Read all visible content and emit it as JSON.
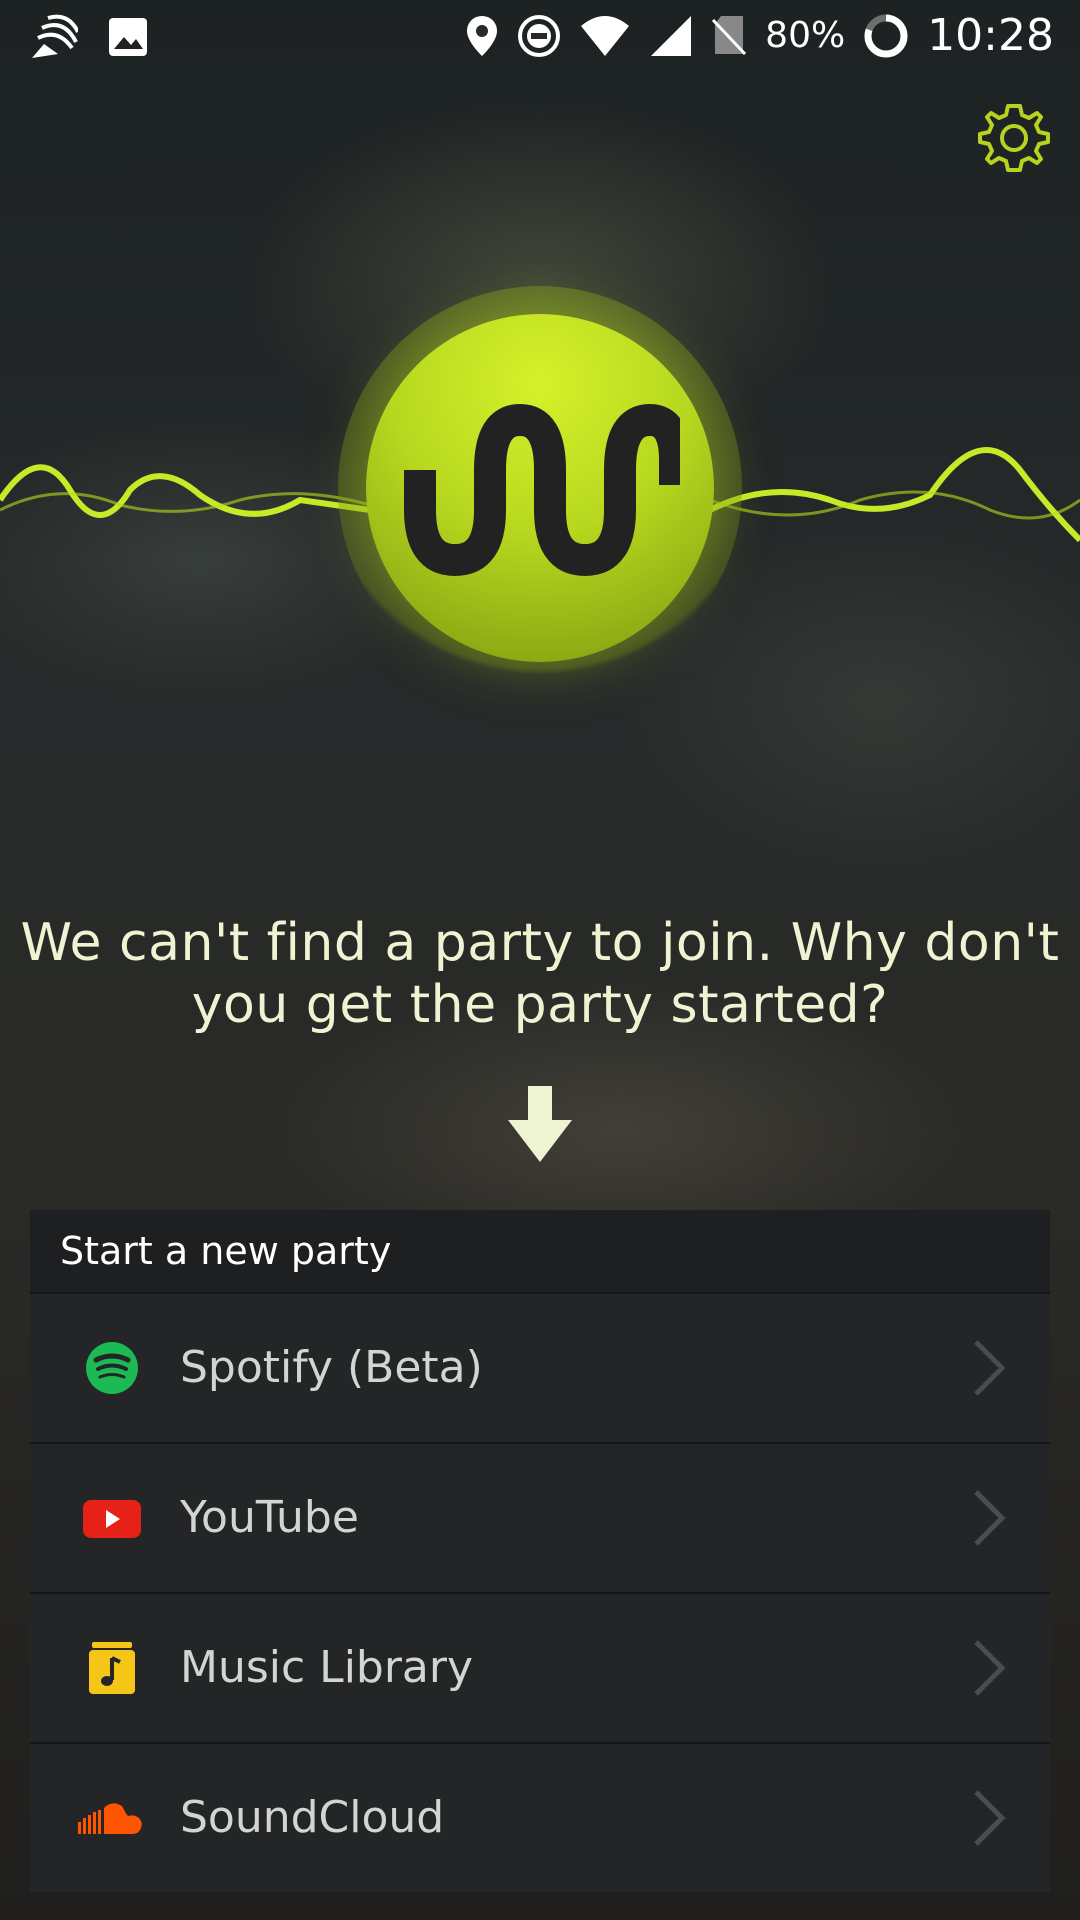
{
  "status_bar": {
    "battery_percent": "80%",
    "time": "10:28",
    "icons": [
      "cast-icon",
      "gallery-icon",
      "location-icon",
      "do-not-disturb-icon",
      "wifi-icon",
      "signal-icon",
      "no-sim-icon",
      "battery-icon"
    ]
  },
  "header": {
    "settings_icon": "gear-icon"
  },
  "logo": {
    "name": "app-logo"
  },
  "main": {
    "message": "We can't find a party to join. Why don't you get the party started?"
  },
  "party": {
    "header": "Start a new party",
    "items": [
      {
        "label": "Spotify (Beta)",
        "icon": "spotify-icon",
        "color": "#1db954"
      },
      {
        "label": "YouTube",
        "icon": "youtube-icon",
        "color": "#e62117"
      },
      {
        "label": "Music Library",
        "icon": "music-library-icon",
        "color": "#f5c518"
      },
      {
        "label": "SoundCloud",
        "icon": "soundcloud-icon",
        "color": "#ff5500"
      }
    ]
  },
  "colors": {
    "accent": "#c8e621",
    "text": "#eef3d2"
  }
}
